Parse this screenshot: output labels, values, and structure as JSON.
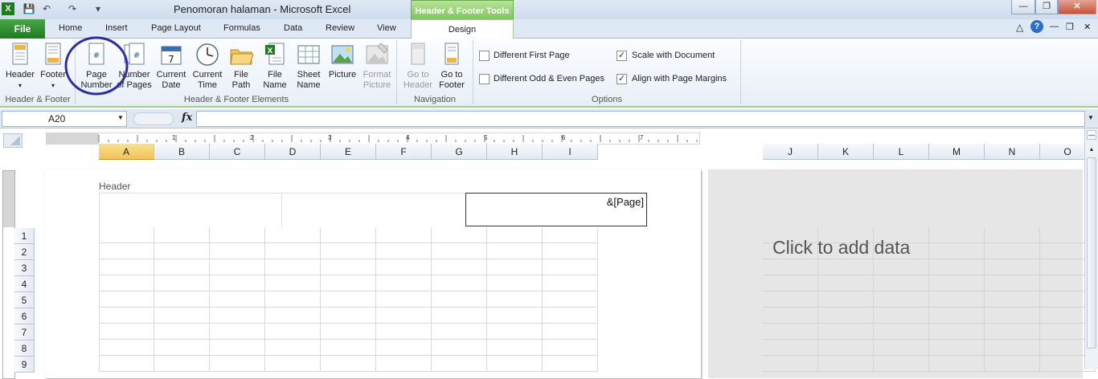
{
  "window": {
    "title": "Penomoran halaman  -  Microsoft Excel",
    "context_group": "Header & Footer Tools"
  },
  "tabs": {
    "file": "File",
    "items": [
      "Home",
      "Insert",
      "Page Layout",
      "Formulas",
      "Data",
      "Review",
      "View"
    ],
    "design": "Design"
  },
  "ribbon": {
    "groups": {
      "header_footer": "Header & Footer",
      "elements": "Header & Footer Elements",
      "navigation": "Navigation",
      "options": "Options"
    },
    "buttons": {
      "header": "Header",
      "footer": "Footer",
      "page_number_1": "Page",
      "page_number_2": "Number",
      "num_pages_1": "Number",
      "num_pages_2": "of Pages",
      "current_date_1": "Current",
      "current_date_2": "Date",
      "current_time_1": "Current",
      "current_time_2": "Time",
      "file_path_1": "File",
      "file_path_2": "Path",
      "file_name_1": "File",
      "file_name_2": "Name",
      "sheet_name_1": "Sheet",
      "sheet_name_2": "Name",
      "picture": "Picture",
      "format_picture_1": "Format",
      "format_picture_2": "Picture",
      "goto_header_1": "Go to",
      "goto_header_2": "Header",
      "goto_footer_1": "Go to",
      "goto_footer_2": "Footer"
    },
    "options": {
      "different_first_page": {
        "label": "Different First Page",
        "checked": false
      },
      "different_odd_even": {
        "label": "Different Odd & Even Pages",
        "checked": false
      },
      "scale_with_document": {
        "label": "Scale with Document",
        "checked": true
      },
      "align_with_margins": {
        "label": "Align with Page Margins",
        "checked": true
      }
    }
  },
  "formula_bar": {
    "name_box": "A20",
    "fx": "fx",
    "formula": ""
  },
  "ruler_numbers": [
    "1",
    "2",
    "3",
    "4",
    "5",
    "6",
    "7"
  ],
  "columns_page": [
    "A",
    "B",
    "C",
    "D",
    "E",
    "F",
    "G",
    "H",
    "I"
  ],
  "columns_right": [
    "J",
    "K",
    "L",
    "M",
    "N",
    "O"
  ],
  "rows": [
    "1",
    "2",
    "3",
    "4",
    "5",
    "6",
    "7",
    "8",
    "9"
  ],
  "page": {
    "header_label": "Header",
    "right_section_text": "&[Page]",
    "add_data_text": "Click to add data"
  },
  "colors": {
    "accent_green": "#1e7b1e",
    "context_green": "#7dc75a",
    "selected_header": "#f1c35a",
    "annotation_circle": "#2b2fa0"
  }
}
